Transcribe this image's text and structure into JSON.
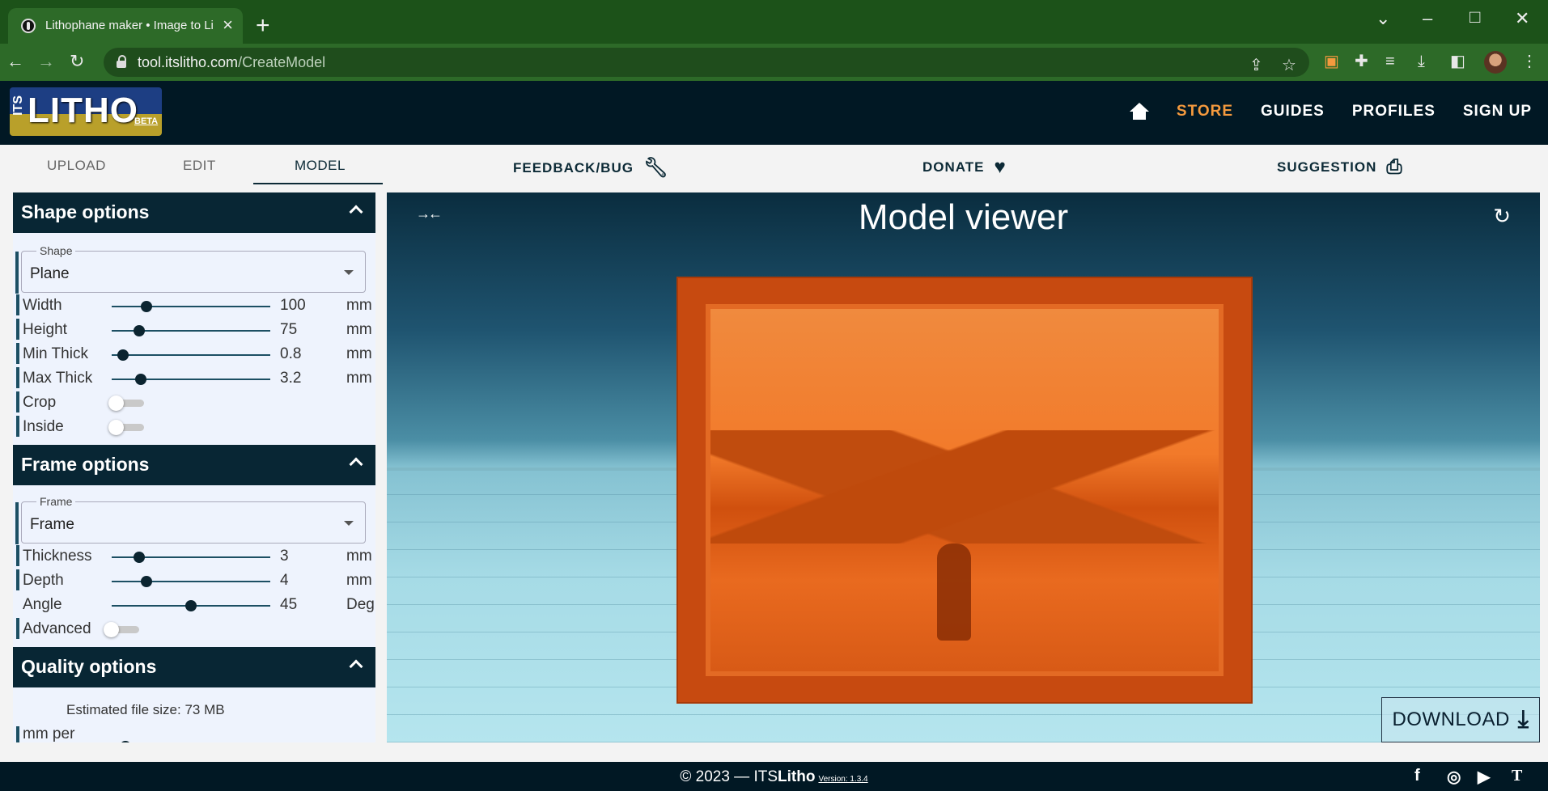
{
  "browser": {
    "tab_title": "Lithophane maker • Image to Lith",
    "url_host": "tool.itslitho.com",
    "url_path": "/CreateModel"
  },
  "site": {
    "logo": {
      "its": "ITS",
      "main": "LITHO",
      "beta": "BETA"
    },
    "nav": [
      "STORE",
      "GUIDES",
      "PROFILES",
      "SIGN UP"
    ],
    "active_nav": "STORE",
    "accent_color": "#f59a3e"
  },
  "subnav": {
    "tabs": [
      "UPLOAD",
      "EDIT",
      "MODEL"
    ],
    "active": "MODEL",
    "actions": [
      "FEEDBACK/BUG",
      "DONATE",
      "SUGGESTION"
    ]
  },
  "shape_options": {
    "title": "Shape options",
    "shape_label": "Shape",
    "shape_value": "Plane",
    "sliders": [
      {
        "label": "Width",
        "value": "100",
        "unit": "mm",
        "fraction": 0.2
      },
      {
        "label": "Height",
        "value": "75",
        "unit": "mm",
        "fraction": 0.15
      },
      {
        "label": "Min Thick",
        "value": "0.8",
        "unit": "mm",
        "fraction": 0.04
      },
      {
        "label": "Max Thick",
        "value": "3.2",
        "unit": "mm",
        "fraction": 0.16
      }
    ],
    "toggles": [
      {
        "label": "Crop",
        "on": false
      },
      {
        "label": "Inside",
        "on": false
      }
    ]
  },
  "frame_options": {
    "title": "Frame options",
    "frame_label": "Frame",
    "frame_value": "Frame",
    "sliders": [
      {
        "label": "Thickness",
        "value": "3",
        "unit": "mm",
        "fraction": 0.15
      },
      {
        "label": "Depth",
        "value": "4",
        "unit": "mm",
        "fraction": 0.2
      },
      {
        "label": "Angle",
        "value": "45",
        "unit": "Deg",
        "fraction": 0.5
      }
    ],
    "advanced_label": "Advanced"
  },
  "quality_options": {
    "title": "Quality options",
    "file_size": "Estimated file size: 73 MB",
    "partial_row_label": "mm per"
  },
  "viewer": {
    "title": "Model viewer",
    "download_label": "DOWNLOAD",
    "model_color": "#e8661f"
  },
  "footer": {
    "copyright": "© 2023 — ITS",
    "brand_bold": "Litho",
    "version": "Version: 1.3.4"
  }
}
